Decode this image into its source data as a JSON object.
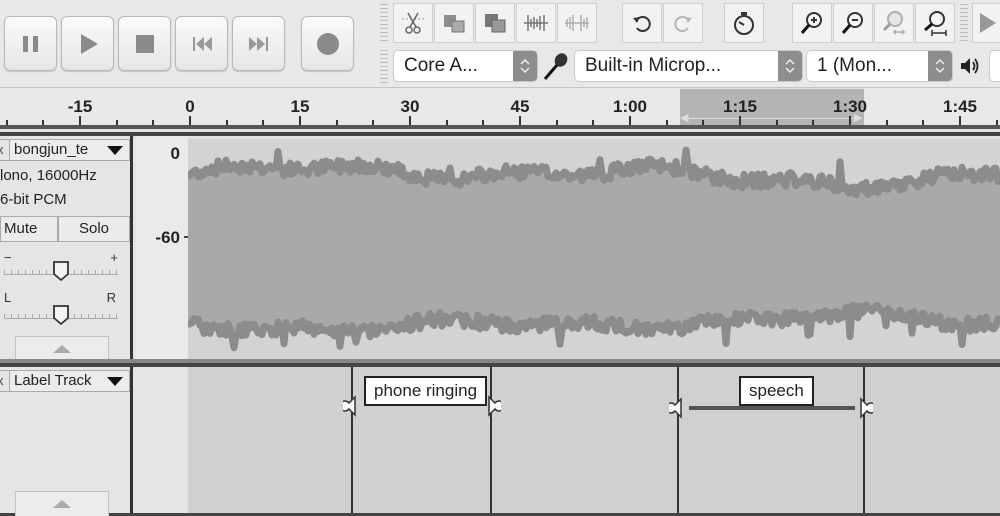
{
  "transport": {
    "buttons": [
      {
        "name": "pause",
        "icon": "pause-icon"
      },
      {
        "name": "play",
        "icon": "play-icon"
      },
      {
        "name": "stop",
        "icon": "stop-icon"
      },
      {
        "name": "skip-to-start",
        "icon": "skip-start-icon"
      },
      {
        "name": "skip-to-end",
        "icon": "skip-end-icon"
      },
      {
        "name": "record",
        "icon": "record-icon"
      }
    ]
  },
  "edit_tools": [
    "cut-icon",
    "copy-icon",
    "paste-icon",
    "trim-icon",
    "silence-icon"
  ],
  "history_tools": [
    "undo-icon",
    "redo-icon"
  ],
  "timer_tool": "timer-icon",
  "zoom_tools": [
    "zoom-in-icon",
    "zoom-out-icon",
    "fit-selection-icon",
    "fit-project-icon"
  ],
  "devices": {
    "host": "Core A...",
    "input_device": "Built-in Microp...",
    "channels": "1 (Mon..."
  },
  "ruler": {
    "labels": [
      "-15",
      "0",
      "15",
      "30",
      "45",
      "1:00",
      "1:15",
      "1:30",
      "1:45"
    ],
    "selection": {
      "start": "1:05",
      "end": "1:30"
    }
  },
  "audio_track": {
    "name": "bongjun_te",
    "info_line1": "lono, 16000Hz",
    "info_line2": "6-bit PCM",
    "mute_label": "Mute",
    "solo_label": "Solo",
    "gain_minus": "−",
    "gain_plus": "+",
    "pan_left": "L",
    "pan_right": "R",
    "gain_value": 0.5,
    "pan_value": 0.5,
    "scale_top": "0",
    "scale_mid": "-60"
  },
  "label_track": {
    "name": "Label Track",
    "labels": [
      {
        "text": "phone ringing",
        "start": "0:27",
        "end": "0:40"
      },
      {
        "text": "speech",
        "start": "1:05",
        "end": "1:30"
      }
    ]
  }
}
